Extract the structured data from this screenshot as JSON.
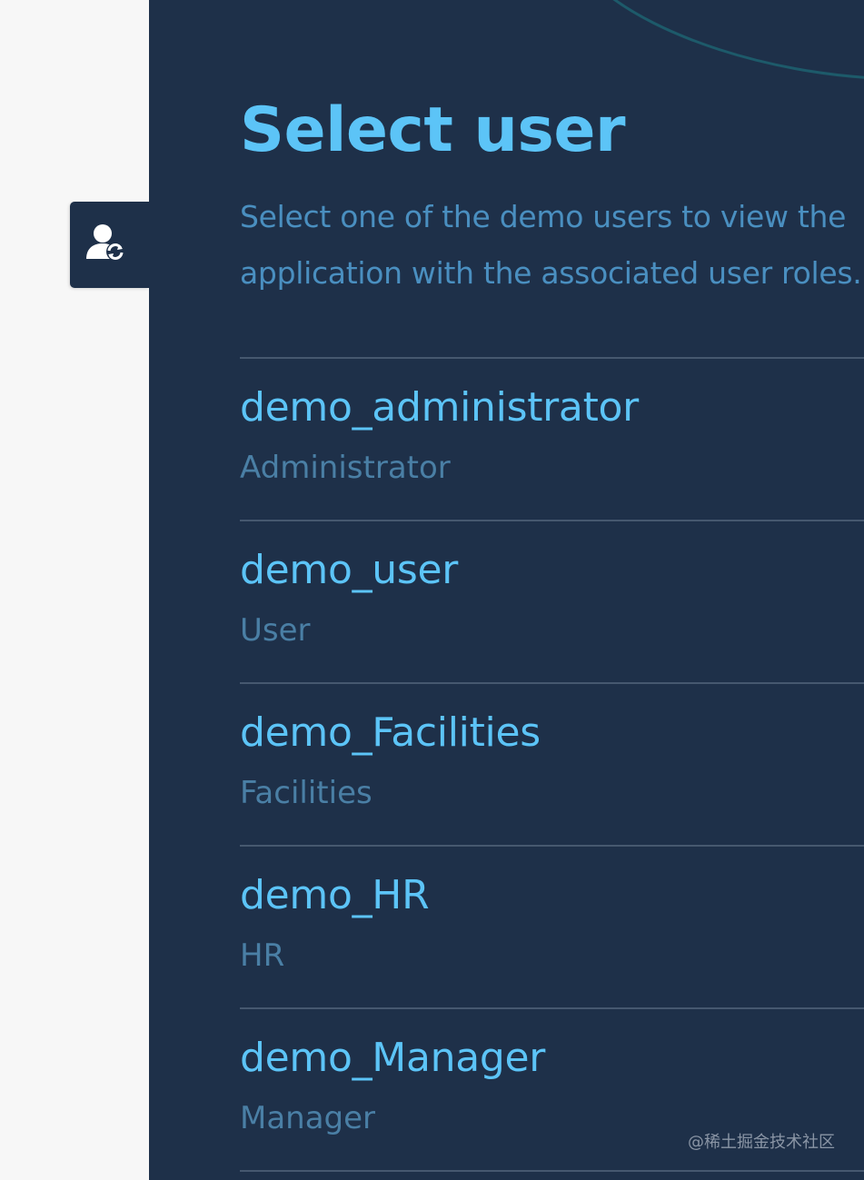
{
  "switcher": {
    "icon": "user-switch-icon"
  },
  "panel": {
    "title": "Select user",
    "subtitle": "Select one of the demo users to view the application with the associated user roles."
  },
  "users": [
    {
      "name": "demo_administrator",
      "role": "Administrator"
    },
    {
      "name": "demo_user",
      "role": "User"
    },
    {
      "name": "demo_Facilities",
      "role": "Facilities"
    },
    {
      "name": "demo_HR",
      "role": "HR"
    },
    {
      "name": "demo_Manager",
      "role": "Manager"
    }
  ],
  "watermark": "@稀土掘金技术社区",
  "colors": {
    "panel_bg": "#1e3049",
    "accent": "#5cc4f7",
    "muted": "#4a8fc0",
    "divider": "#46586f",
    "page_bg": "#f7f7f7"
  }
}
